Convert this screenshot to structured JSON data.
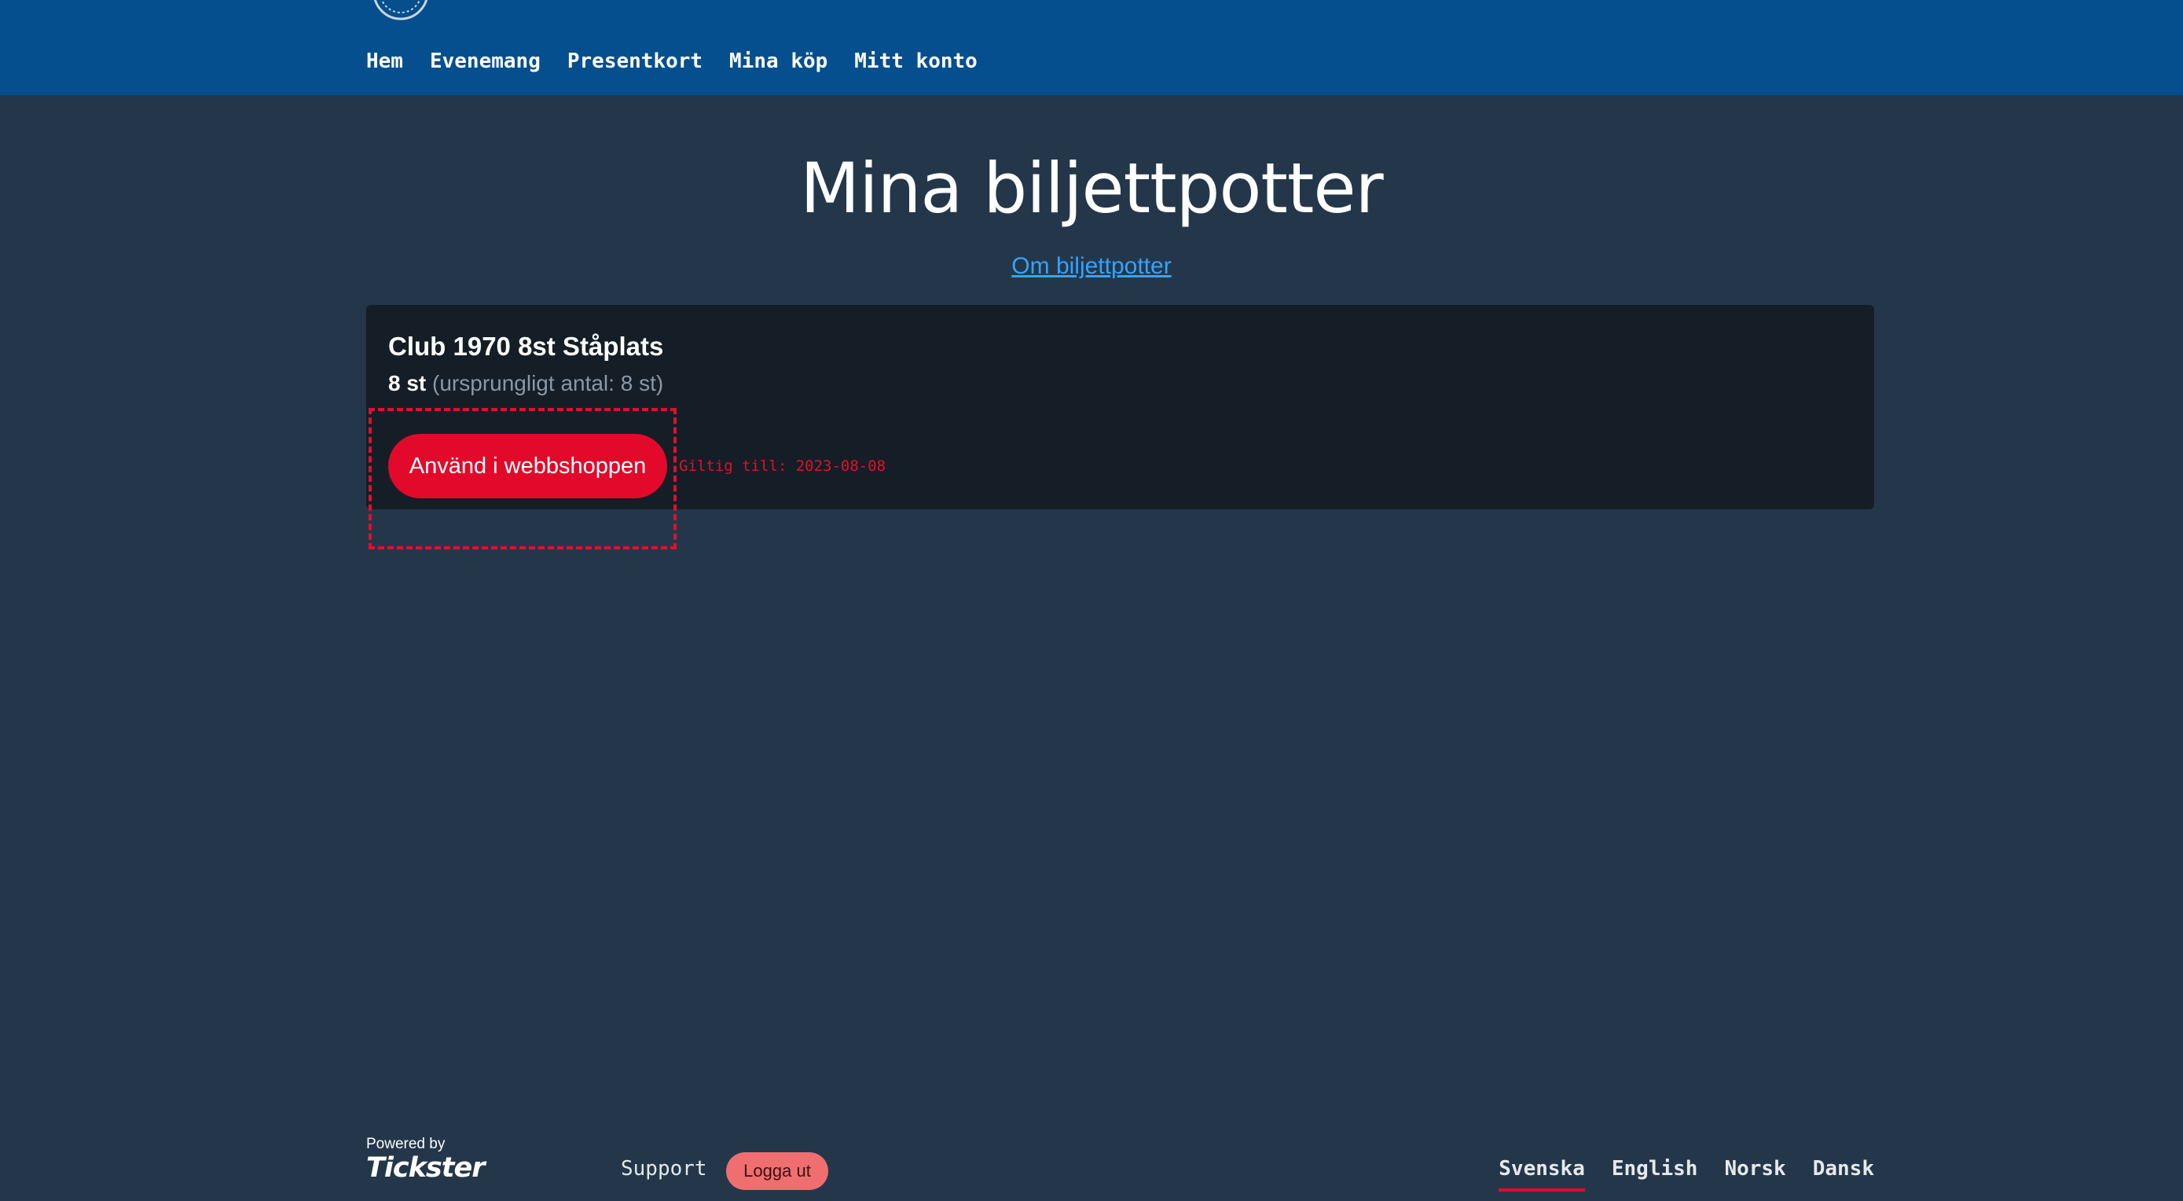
{
  "header": {
    "nav": [
      "Hem",
      "Evenemang",
      "Presentkort",
      "Mina köp",
      "Mitt konto"
    ]
  },
  "main": {
    "title": "Mina biljettpotter",
    "about_link": "Om biljettpotter",
    "card": {
      "title": "Club 1970 8st Ståplats",
      "count": "8 st",
      "original": "(ursprungligt antal: 8 st)",
      "button_label": "Använd i webbshoppen",
      "valid_until": "Giltig till: 2023-08-08"
    }
  },
  "footer": {
    "powered_by": "Powered by",
    "brand": "Tickster",
    "support": "Support",
    "logout": "Logga ut",
    "languages": [
      "Svenska",
      "English",
      "Norsk",
      "Dansk"
    ],
    "active_language": "Svenska"
  },
  "colors": {
    "header_bg": "#054f8e",
    "page_bg": "#24374a",
    "card_bg": "#151e27",
    "accent_red": "#e3092b",
    "link_blue": "#33a3ff",
    "logout_bg": "#ef6e70"
  }
}
